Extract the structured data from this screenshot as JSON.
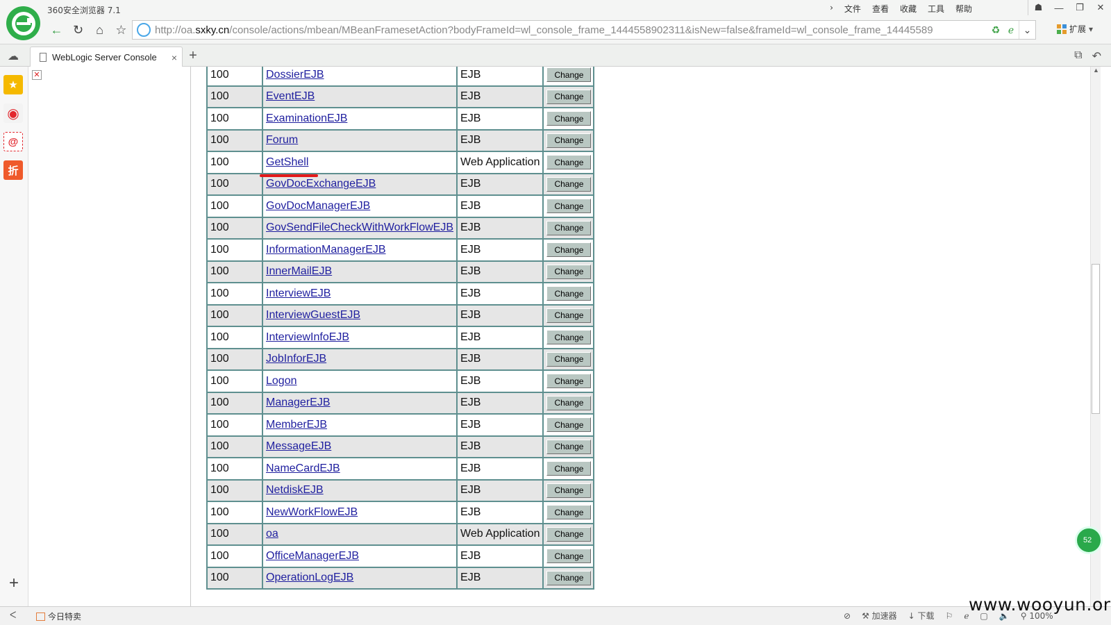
{
  "browser": {
    "app_title": "360安全浏览器 7.1",
    "menu": [
      "文件",
      "查看",
      "收藏",
      "工具",
      "帮助"
    ],
    "url_prefix": "http://oa.",
    "url_host": "sxky.cn",
    "url_rest": "/console/actions/mbean/MBeanFramesetAction?bodyFrameId=wl_console_frame_1444558902311&isNew=false&frameId=wl_console_frame_14445589",
    "extension_label": "扩展",
    "tab_title": "WebLogic Server Console"
  },
  "table": {
    "action_label": "Change",
    "rows": [
      {
        "num": "100",
        "name": "DossierEJB",
        "type": "EJB"
      },
      {
        "num": "100",
        "name": "EventEJB",
        "type": "EJB"
      },
      {
        "num": "100",
        "name": "ExaminationEJB",
        "type": "EJB"
      },
      {
        "num": "100",
        "name": "Forum",
        "type": "EJB"
      },
      {
        "num": "100",
        "name": "GetShell",
        "type": "Web Application"
      },
      {
        "num": "100",
        "name": "GovDocExchangeEJB",
        "type": "EJB"
      },
      {
        "num": "100",
        "name": "GovDocManagerEJB",
        "type": "EJB"
      },
      {
        "num": "100",
        "name": "GovSendFileCheckWithWorkFlowEJB",
        "type": "EJB"
      },
      {
        "num": "100",
        "name": "InformationManagerEJB",
        "type": "EJB"
      },
      {
        "num": "100",
        "name": "InnerMailEJB",
        "type": "EJB"
      },
      {
        "num": "100",
        "name": "InterviewEJB",
        "type": "EJB"
      },
      {
        "num": "100",
        "name": "InterviewGuestEJB",
        "type": "EJB"
      },
      {
        "num": "100",
        "name": "InterviewInfoEJB",
        "type": "EJB"
      },
      {
        "num": "100",
        "name": "JobInforEJB",
        "type": "EJB"
      },
      {
        "num": "100",
        "name": "Logon",
        "type": "EJB"
      },
      {
        "num": "100",
        "name": "ManagerEJB",
        "type": "EJB"
      },
      {
        "num": "100",
        "name": "MemberEJB",
        "type": "EJB"
      },
      {
        "num": "100",
        "name": "MessageEJB",
        "type": "EJB"
      },
      {
        "num": "100",
        "name": "NameCardEJB",
        "type": "EJB"
      },
      {
        "num": "100",
        "name": "NetdiskEJB",
        "type": "EJB"
      },
      {
        "num": "100",
        "name": "NewWorkFlowEJB",
        "type": "EJB"
      },
      {
        "num": "100",
        "name": "oa",
        "type": "Web Application"
      },
      {
        "num": "100",
        "name": "OfficeManagerEJB",
        "type": "EJB"
      },
      {
        "num": "100",
        "name": "OperationLogEJB",
        "type": "EJB"
      }
    ]
  },
  "statusbar": {
    "deals_label": "今日特卖",
    "accelerator_label": "加速器",
    "download_label": "下载",
    "zoom": "100%"
  },
  "side": {
    "deal_icon_text": "折",
    "notification_count": "52"
  },
  "watermark": "www.wooyun.org",
  "colors": {
    "link": "#1f1f9f",
    "row_alt": "#e6e6e6",
    "border": "#5e8f8f",
    "button": "#b9c7c2",
    "highlight": "#e31a1a"
  }
}
